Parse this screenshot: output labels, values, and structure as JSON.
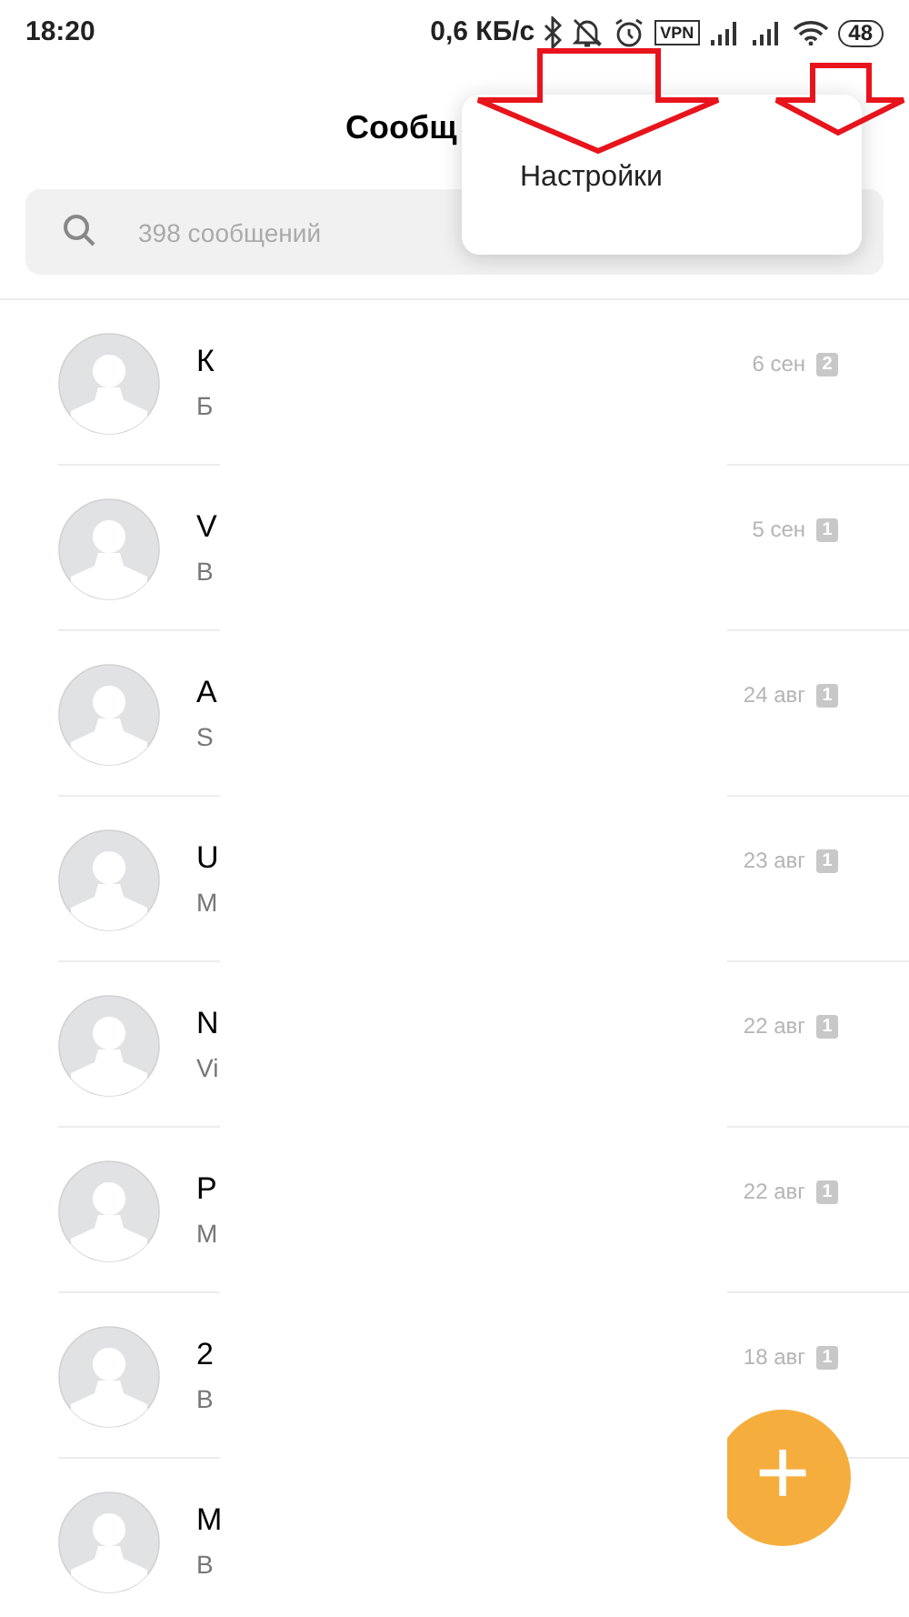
{
  "status_bar": {
    "time": "18:20",
    "speed": "0,6 КБ/с",
    "vpn": "VPN",
    "battery": "48"
  },
  "header": {
    "title": "Сообщ"
  },
  "menu": {
    "items": [
      {
        "label": "Настройки"
      }
    ]
  },
  "search": {
    "placeholder": "398 сообщений"
  },
  "conversations": [
    {
      "name": "К",
      "preview": "Б",
      "date": "6 сен",
      "unread": "2"
    },
    {
      "name": "V",
      "preview": "В",
      "date": "5 сен",
      "unread": "1"
    },
    {
      "name": "A",
      "preview": "S",
      "date": "24 авг",
      "unread": "1"
    },
    {
      "name": "U",
      "preview": "M",
      "date": "23 авг",
      "unread": "1"
    },
    {
      "name": "N",
      "preview": "Vi",
      "date": "22 авг",
      "unread": "1"
    },
    {
      "name": "P",
      "preview": "M",
      "date": "22 авг",
      "unread": "1"
    },
    {
      "name": "2",
      "preview": "B",
      "date": "18 авг",
      "unread": "1"
    },
    {
      "name": "M",
      "preview": "B"
    }
  ],
  "fab": {
    "label": "+"
  }
}
